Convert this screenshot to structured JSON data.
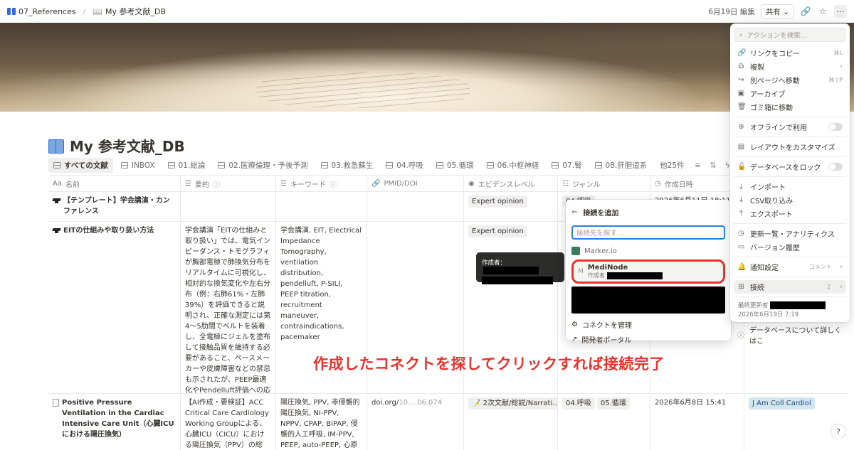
{
  "topbar": {
    "breadcrumb_1": "07_References",
    "breadcrumb_2": "My 参考文献_DB",
    "edited": "6月19日 編集",
    "share": "共有"
  },
  "page": {
    "title": "My 参考文献_DB"
  },
  "tabs": [
    "すべての文献",
    "INBOX",
    "01.総論",
    "02.医療倫理・予後予測",
    "03.救急蘇生",
    "04.呼吸",
    "05.循環",
    "06.中枢神経",
    "07.腎",
    "08.肝胆道系"
  ],
  "tabs_more": "他25件",
  "table": {
    "headers": [
      "名前",
      "要約",
      "キーワード",
      "PMID/DOI",
      "エビデンスレベル",
      "ジャンル",
      "作成日時"
    ],
    "rows": [
      {
        "name": "【テンプレート】学会講演・カンファレンス",
        "summary": "",
        "keywords": "",
        "doi": "",
        "evidence": "Expert opinion",
        "genre": [
          "04.呼吸"
        ],
        "created": "2026年6月11日 18:11"
      },
      {
        "name": "EITの仕組みや取り扱い方法",
        "summary": "学会講演「EITの仕組みと取り扱い」では、電気インピーダンス・トモグラフィが胸部電極で肺換気分布をリアルタイムに可視化し、相対的な換気変化や左右分布（例：右肺61%・左肺39%）を評価できると説明され、正確な測定には第4〜5肋間でベルトを装着し、全電極にジェルを塗布して接触品質を維持する必要があること、ペースメーカーや皮膚障害などの禁忌も示されたが、PEEP最適化やPendelluft評価への応用はまだエビデンスが不確実で今後の期待とされた。",
        "keywords": "学会講演, EIT, Electrical Impedance Tomography, ventilation distribution, pendelluft, P-SILI, PEEP titration, recruitment maneuver, contraindications, pacemaker",
        "doi": "",
        "evidence": "Expert opinion",
        "genre": [],
        "created": ""
      },
      {
        "name": "Positive Pressure Ventilation in the Cardiac Intensive Care Unit（心臓ICUにおける陽圧換気）",
        "summary": "【AI作成・要検証】ACC Critical Care Cardiology Working Groupによる、心臓ICU（CICU）における陽圧換気（PPV）の総説。前半=肺",
        "keywords": "陽圧換気, PPV, 非侵襲的陽圧換気, NI-PPV, NPPV, CPAP, BiPAP, 侵襲的人工呼吸, IM-PPV, PEEP, auto-PEEP, 心原性肺水腫, CPE, 心原性ショック",
        "doi_prefix": "doi.org/",
        "doi_rest": "10.…06.074",
        "evidence": "2次文献/総説/Narrati…",
        "genre": [
          "04.呼吸",
          "05.循環"
        ],
        "created": "2026年6月8日 15:41",
        "journal": "J Am Coll Cardiol"
      }
    ]
  },
  "tooltip": {
    "label": "作成者："
  },
  "connection_popup": {
    "title": "接続を追加",
    "search_placeholder": "接続先を探す...",
    "item_1": "Marker.io",
    "highlight_name": "MediNode",
    "highlight_sub": "作成者",
    "manage": "コネクトを管理",
    "dev_portal": "開発者ポータル"
  },
  "annotation": "作成したコネクトを探してクリックすれば接続完了",
  "action_menu": {
    "search_placeholder": "アクションを検索...",
    "items": [
      {
        "label": "リンクをコピー",
        "shortcut": "⌘L"
      },
      {
        "label": "複製",
        "shortcut": ""
      },
      {
        "label": "別ページへ移動",
        "shortcut": "⌘⇧P"
      },
      {
        "label": "アーカイブ",
        "shortcut": ""
      },
      {
        "label": "ゴミ箱に移動",
        "shortcut": ""
      }
    ],
    "offline": "オフラインで利用",
    "customize": "レイアウトをカスタマイズ",
    "lock": "データベースをロック",
    "import": "インポート",
    "csv": "CSV取り込み",
    "export": "エクスポート",
    "updates": "更新一覧・アナリティクス",
    "history": "バージョン履歴",
    "notify": "通知設定",
    "notify_value": "コメント",
    "connections": "接続",
    "connections_count": "2",
    "last_editor_label": "最終更新者",
    "last_edited": "2026年6月19日 7:19",
    "learn": "データベースについて詳しくはこ"
  }
}
